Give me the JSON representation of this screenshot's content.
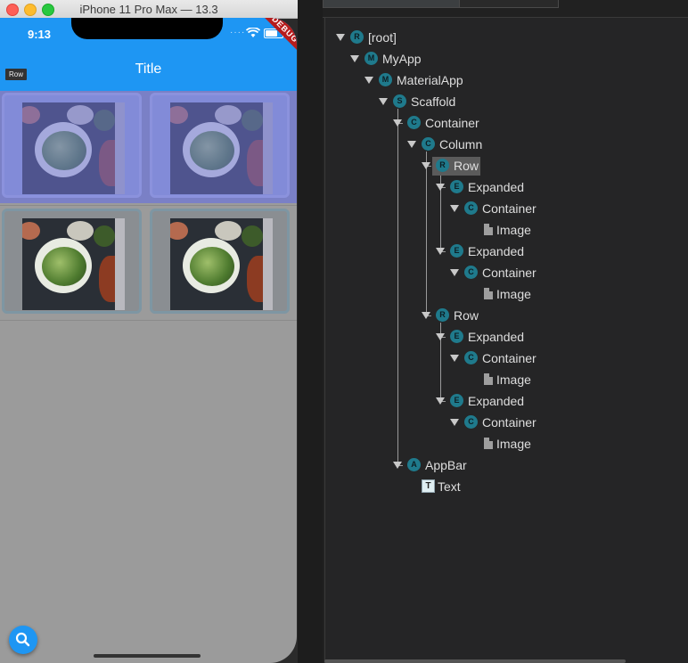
{
  "simulator": {
    "window_title": "iPhone 11 Pro Max — 13.3",
    "status_time": "9:13",
    "debug_banner": "DEBUG",
    "app_title": "Title",
    "row_tooltip": "Row",
    "fab_icon": "search-icon"
  },
  "widget_tree": [
    {
      "label": "[root]",
      "badge": "R",
      "kind": "widget"
    },
    {
      "label": "MyApp",
      "badge": "M",
      "kind": "widget"
    },
    {
      "label": "MaterialApp",
      "badge": "M",
      "kind": "widget"
    },
    {
      "label": "Scaffold",
      "badge": "S",
      "kind": "widget"
    },
    {
      "label": "Container",
      "badge": "C",
      "kind": "widget"
    },
    {
      "label": "Column",
      "badge": "C",
      "kind": "widget"
    },
    {
      "label": "Row",
      "badge": "R",
      "kind": "widget",
      "selected": true
    },
    {
      "label": "Expanded",
      "badge": "E",
      "kind": "widget"
    },
    {
      "label": "Container",
      "badge": "C",
      "kind": "widget"
    },
    {
      "label": "Image",
      "badge": "",
      "kind": "file"
    },
    {
      "label": "Expanded",
      "badge": "E",
      "kind": "widget"
    },
    {
      "label": "Container",
      "badge": "C",
      "kind": "widget"
    },
    {
      "label": "Image",
      "badge": "",
      "kind": "file"
    },
    {
      "label": "Row",
      "badge": "R",
      "kind": "widget"
    },
    {
      "label": "Expanded",
      "badge": "E",
      "kind": "widget"
    },
    {
      "label": "Container",
      "badge": "C",
      "kind": "widget"
    },
    {
      "label": "Image",
      "badge": "",
      "kind": "file"
    },
    {
      "label": "Expanded",
      "badge": "E",
      "kind": "widget"
    },
    {
      "label": "Container",
      "badge": "C",
      "kind": "widget"
    },
    {
      "label": "Image",
      "badge": "",
      "kind": "file"
    },
    {
      "label": "AppBar",
      "badge": "A",
      "kind": "widget"
    },
    {
      "label": "Text",
      "badge": "T",
      "kind": "text"
    }
  ],
  "colors": {
    "app_bar": "#1e96f3",
    "badge": "#1f7a8c",
    "selection": "#5b5b5b",
    "row_highlight": "#7a80c6"
  }
}
